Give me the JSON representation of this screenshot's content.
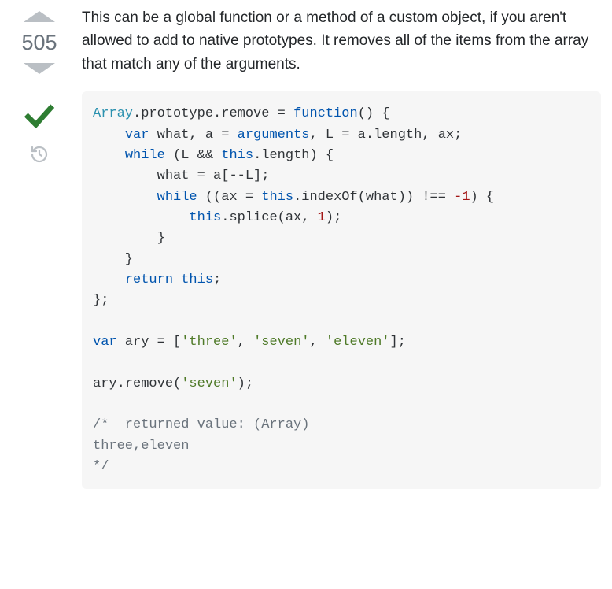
{
  "vote": {
    "count": "505"
  },
  "answer": {
    "text": "This can be a global function or a method of a custom object, if you aren't allowed to add to native prototypes. It removes all of the items from the array that match any of the arguments."
  },
  "code": {
    "tokens": [
      {
        "t": "Array",
        "c": "tok-class"
      },
      {
        "t": ".",
        "c": "tok-punc"
      },
      {
        "t": "prototype",
        "c": "tok-ident"
      },
      {
        "t": ".",
        "c": "tok-punc"
      },
      {
        "t": "remove",
        "c": "tok-ident"
      },
      {
        "t": " = ",
        "c": "tok-punc"
      },
      {
        "t": "function",
        "c": "tok-keyword"
      },
      {
        "t": "() {",
        "c": "tok-punc"
      },
      {
        "t": "\n    ",
        "c": ""
      },
      {
        "t": "var",
        "c": "tok-keyword"
      },
      {
        "t": " what, a = ",
        "c": "tok-ident"
      },
      {
        "t": "arguments",
        "c": "tok-builtin"
      },
      {
        "t": ", L = a.",
        "c": "tok-ident"
      },
      {
        "t": "length",
        "c": "tok-ident"
      },
      {
        "t": ", ax;",
        "c": "tok-ident"
      },
      {
        "t": "\n    ",
        "c": ""
      },
      {
        "t": "while",
        "c": "tok-keyword"
      },
      {
        "t": " (L && ",
        "c": "tok-punc"
      },
      {
        "t": "this",
        "c": "tok-keyword"
      },
      {
        "t": ".",
        "c": "tok-punc"
      },
      {
        "t": "length",
        "c": "tok-ident"
      },
      {
        "t": ") {",
        "c": "tok-punc"
      },
      {
        "t": "\n        ",
        "c": ""
      },
      {
        "t": "what = a[--L];",
        "c": "tok-ident"
      },
      {
        "t": "\n        ",
        "c": ""
      },
      {
        "t": "while",
        "c": "tok-keyword"
      },
      {
        "t": " ((ax = ",
        "c": "tok-punc"
      },
      {
        "t": "this",
        "c": "tok-keyword"
      },
      {
        "t": ".",
        "c": "tok-punc"
      },
      {
        "t": "indexOf",
        "c": "tok-ident"
      },
      {
        "t": "(what)) !== ",
        "c": "tok-punc"
      },
      {
        "t": "-1",
        "c": "tok-number"
      },
      {
        "t": ") {",
        "c": "tok-punc"
      },
      {
        "t": "\n            ",
        "c": ""
      },
      {
        "t": "this",
        "c": "tok-keyword"
      },
      {
        "t": ".",
        "c": "tok-punc"
      },
      {
        "t": "splice",
        "c": "tok-ident"
      },
      {
        "t": "(ax, ",
        "c": "tok-punc"
      },
      {
        "t": "1",
        "c": "tok-number"
      },
      {
        "t": ");",
        "c": "tok-punc"
      },
      {
        "t": "\n        }",
        "c": "tok-punc"
      },
      {
        "t": "\n    }",
        "c": "tok-punc"
      },
      {
        "t": "\n    ",
        "c": ""
      },
      {
        "t": "return",
        "c": "tok-keyword"
      },
      {
        "t": " ",
        "c": ""
      },
      {
        "t": "this",
        "c": "tok-keyword"
      },
      {
        "t": ";",
        "c": "tok-punc"
      },
      {
        "t": "\n};",
        "c": "tok-punc"
      },
      {
        "t": "\n\n",
        "c": ""
      },
      {
        "t": "var",
        "c": "tok-keyword"
      },
      {
        "t": " ary = [",
        "c": "tok-ident"
      },
      {
        "t": "'three'",
        "c": "tok-string"
      },
      {
        "t": ", ",
        "c": "tok-punc"
      },
      {
        "t": "'seven'",
        "c": "tok-string"
      },
      {
        "t": ", ",
        "c": "tok-punc"
      },
      {
        "t": "'eleven'",
        "c": "tok-string"
      },
      {
        "t": "];",
        "c": "tok-punc"
      },
      {
        "t": "\n\n",
        "c": ""
      },
      {
        "t": "ary.",
        "c": "tok-ident"
      },
      {
        "t": "remove",
        "c": "tok-ident"
      },
      {
        "t": "(",
        "c": "tok-punc"
      },
      {
        "t": "'seven'",
        "c": "tok-string"
      },
      {
        "t": ");",
        "c": "tok-punc"
      },
      {
        "t": "\n\n",
        "c": ""
      },
      {
        "t": "/*  returned value: (Array)\nthree,eleven\n*/",
        "c": "tok-comment"
      }
    ]
  }
}
